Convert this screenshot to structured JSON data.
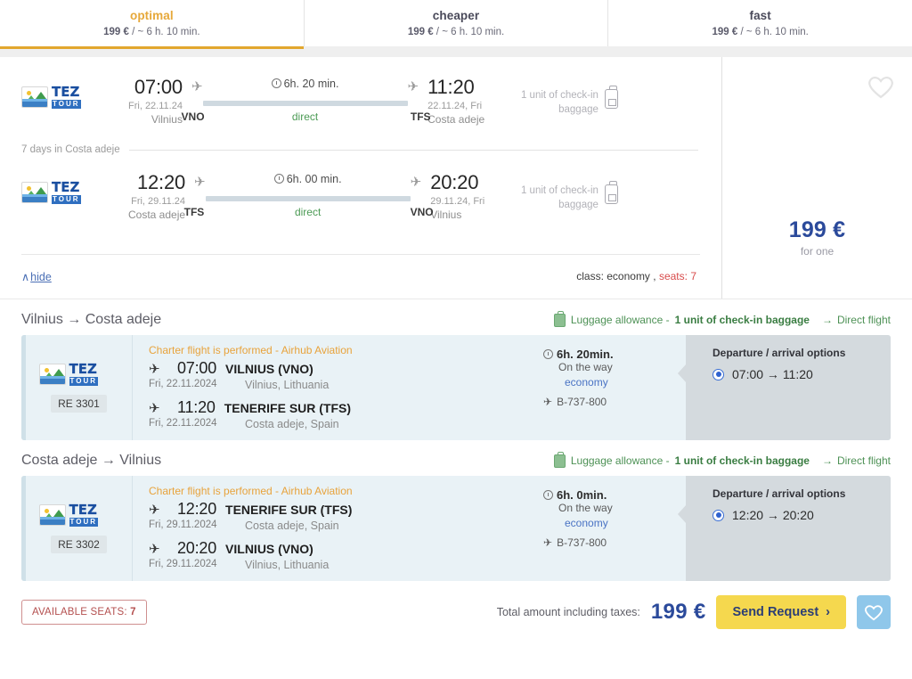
{
  "tabs": [
    {
      "label": "optimal",
      "price": "199 €",
      "sep": "/",
      "duration": "~ 6 h. 10 min.",
      "active": true
    },
    {
      "label": "cheaper",
      "price": "199 €",
      "sep": "/",
      "duration": "~ 6 h. 10 min.",
      "active": false
    },
    {
      "label": "fast",
      "price": "199 €",
      "sep": "/",
      "duration": "~ 6 h. 10 min.",
      "active": false
    }
  ],
  "summary": {
    "airline_logo_alt": "TEZ TOUR",
    "logo_tez": "TEZ",
    "logo_tour": "TOUR",
    "legs": [
      {
        "dep_time": "07:00",
        "dep_date": "Fri, 22.11.24",
        "dep_city": "Vilnius",
        "dep_code": "VNO",
        "duration": "6h. 20 min.",
        "stops": "direct",
        "arr_time": "11:20",
        "arr_date": "22.11.24, Fri",
        "arr_city": "Costa adeje",
        "arr_code": "TFS",
        "baggage": "1 unit of check-in baggage"
      },
      {
        "dep_time": "12:20",
        "dep_date": "Fri, 29.11.24",
        "dep_city": "Costa adeje",
        "dep_code": "TFS",
        "duration": "6h. 00 min.",
        "stops": "direct",
        "arr_time": "20:20",
        "arr_date": "29.11.24, Fri",
        "arr_city": "Vilnius",
        "arr_code": "VNO",
        "baggage": "1 unit of check-in baggage"
      }
    ],
    "stay_note": "7 days in Costa adeje",
    "hide_label": "hide",
    "hide_caret": "∧",
    "class_label": "class: economy ,",
    "seats_label": "seats:",
    "seats_value": "7",
    "price": "199 €",
    "price_note": "for one"
  },
  "segments": [
    {
      "title": "Vilnius → Costa adeje",
      "luggage_label": "Luggage allowance -",
      "luggage_value": "1 unit of check-in baggage",
      "direct_label": "Direct flight",
      "direct_arrow": "→",
      "flight_number": "RE 3301",
      "charter_note": "Charter flight is performed - Airhub Aviation",
      "dep_time": "07:00",
      "dep_airport": "VILNIUS (VNO)",
      "dep_date": "Fri, 22.11.2024",
      "dep_city": "Vilnius, Lithuania",
      "arr_time": "11:20",
      "arr_airport": "TENERIFE SUR (TFS)",
      "arr_date": "Fri, 22.11.2024",
      "arr_city": "Costa adeje, Spain",
      "duration": "6h. 20min.",
      "on_the_way": "On the way",
      "cabin_class": "economy",
      "aircraft": "B-737-800",
      "options_title": "Departure / arrival options",
      "option_value": "07:00 → 11:20"
    },
    {
      "title": "Costa adeje → Vilnius",
      "luggage_label": "Luggage allowance -",
      "luggage_value": "1 unit of check-in baggage",
      "direct_label": "Direct flight",
      "direct_arrow": "→",
      "flight_number": "RE 3302",
      "charter_note": "Charter flight is performed - Airhub Aviation",
      "dep_time": "12:20",
      "dep_airport": "TENERIFE SUR (TFS)",
      "dep_date": "Fri, 29.11.2024",
      "dep_city": "Costa adeje, Spain",
      "arr_time": "20:20",
      "arr_airport": "VILNIUS (VNO)",
      "arr_date": "Fri, 29.11.2024",
      "arr_city": "Vilnius, Lithuania",
      "duration": "6h. 0min.",
      "on_the_way": "On the way",
      "cabin_class": "economy",
      "aircraft": "B-737-800",
      "options_title": "Departure / arrival options",
      "option_value": "12:20 → 20:20"
    }
  ],
  "footer": {
    "available_seats_label": "AVAILABLE SEATS:",
    "available_seats_value": "7",
    "total_label": "Total amount including taxes:",
    "total_amount": "199 €",
    "send_request_label": "Send Request",
    "send_request_chevron": "›"
  },
  "colors": {
    "accent_tab": "#e2a72e",
    "price_blue": "#2b4a9b",
    "green": "#4d9155",
    "charter_orange": "#e8a33c",
    "seats_red": "#d84b4b",
    "button_yellow": "#f5d84e",
    "fav_blue": "#8fc7ea",
    "card_bg": "#e9f2f6",
    "options_bg": "#d4dade"
  }
}
